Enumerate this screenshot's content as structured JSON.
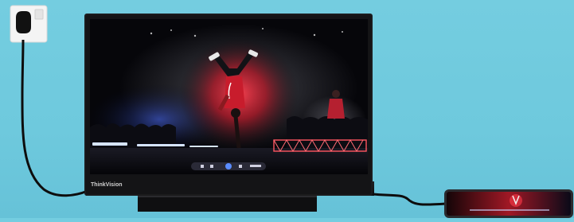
{
  "scene": {
    "background_color": "#6ec9dd",
    "monitor": {
      "brand_label": "ThinkVision",
      "bezel_color": "#1b1b1d",
      "stand_color": "#111113"
    },
    "screen_content": {
      "description_icon": "breakdancer-on-stage",
      "stage_light_colors": [
        "#e0202a",
        "#ff4a5a",
        "#4a78ff"
      ],
      "media_controls": [
        "prev-icon",
        "rewind-icon",
        "play-icon",
        "forward-icon",
        "next-icon"
      ]
    },
    "wall_socket": {
      "color": "#f2f2f2"
    },
    "cable": {
      "color": "#0d0d0d"
    },
    "phone": {
      "body_color": "#2a2a2e"
    }
  }
}
